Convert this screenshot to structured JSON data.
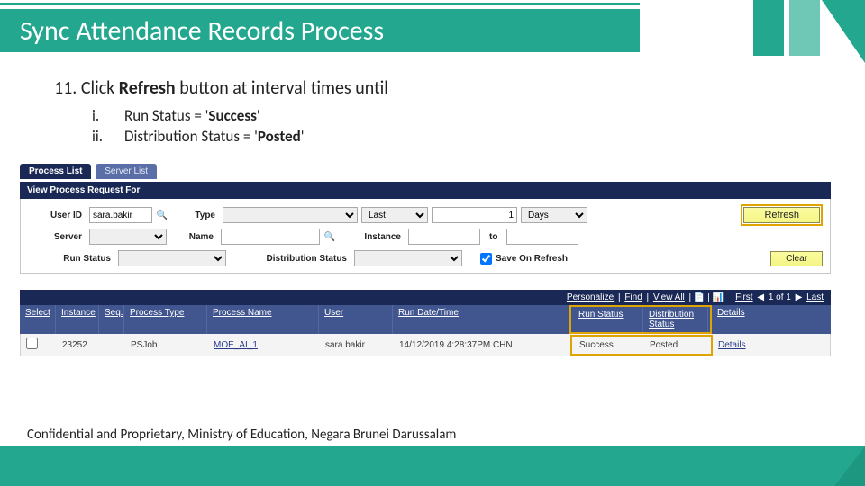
{
  "slide": {
    "title": "Sync Attendance Records Process",
    "step_number": "11.",
    "step_text_prefix": "Click ",
    "step_text_bold": "Refresh",
    "step_text_suffix": " button at interval times until",
    "substeps": [
      {
        "num": "i.",
        "pre": "Run Status = '",
        "bold": "Success",
        "post": "'"
      },
      {
        "num": "ii.",
        "pre": "Distribution Status = '",
        "bold": "Posted",
        "post": "'"
      }
    ],
    "footer": "Confidential and Proprietary, Ministry of Education, Negara Brunei Darussalam"
  },
  "ui": {
    "tabs": {
      "active": "Process List",
      "inactive": "Server List"
    },
    "section_label": "View Process Request For",
    "row1": {
      "user_id_label": "User ID",
      "user_id_value": "sara.bakir",
      "type_label": "Type",
      "type_value": "",
      "period_label": "Last",
      "period_qty": "1",
      "period_unit": "Days",
      "refresh": "Refresh"
    },
    "row2": {
      "server_label": "Server",
      "server_value": "",
      "name_label": "Name",
      "name_value": "",
      "instance_label": "Instance",
      "instance_from": "",
      "to_label": "to",
      "instance_to": ""
    },
    "row3": {
      "run_status_label": "Run Status",
      "run_status_value": "",
      "dist_status_label": "Distribution Status",
      "dist_status_value": "",
      "save_on_refresh_label": "Save On Refresh",
      "save_on_refresh_checked": true,
      "clear": "Clear"
    },
    "toolbar": {
      "personalize": "Personalize",
      "find": "Find",
      "viewall": "View All",
      "first": "First",
      "range": "1 of 1",
      "last": "Last"
    },
    "headers": {
      "select": "Select",
      "instance": "Instance",
      "seq": "Seq.",
      "ptype": "Process Type",
      "pname": "Process Name",
      "user": "User",
      "rdt": "Run Date/Time",
      "rs": "Run Status",
      "ds": "Distribution Status",
      "det": "Details"
    },
    "row": {
      "select": false,
      "instance": "23252",
      "seq": "",
      "ptype": "PSJob",
      "pname": "MOE_AI_1",
      "user": "sara.bakir",
      "rdt": "14/12/2019  4:28:37PM CHN",
      "rs": "Success",
      "ds": "Posted",
      "det": "Details"
    }
  }
}
